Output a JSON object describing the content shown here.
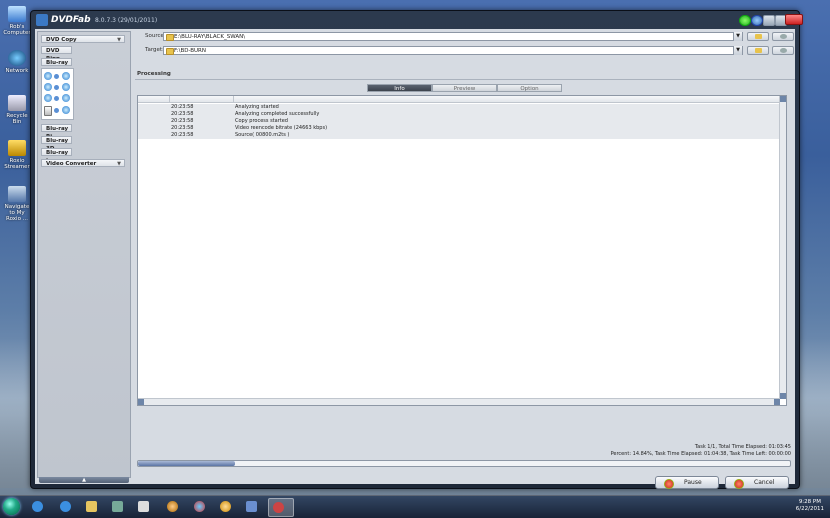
{
  "desktop": {
    "icons": [
      {
        "label": "Rob's Computer"
      },
      {
        "label": "Network"
      },
      {
        "label": "Recycle Bin"
      },
      {
        "label": "Roxio Streamer"
      },
      {
        "label": "Navigate to My Roxio ..."
      }
    ]
  },
  "window": {
    "app_name": "DVDFab",
    "version": "8.0.7.3 (29/01/2011)"
  },
  "sidebar": {
    "items": [
      {
        "label": "DVD Copy"
      },
      {
        "label": "DVD Ripp"
      },
      {
        "label": "Blu-ray Co"
      },
      {
        "label": "Blu-ray Ri"
      },
      {
        "label": "Blu-ray 3D"
      },
      {
        "label": "Blu-ray to"
      },
      {
        "label": "Video Converter"
      }
    ]
  },
  "source": {
    "label": "Source:",
    "value": "E:\\BLU-RAY\\BLACK_SWAN\\"
  },
  "target": {
    "label": "Target:",
    "value": "F:\\BD-BURN"
  },
  "section": {
    "title": "Processing"
  },
  "tabs": [
    {
      "label": "Info"
    },
    {
      "label": "Preview"
    },
    {
      "label": "Option"
    }
  ],
  "log": {
    "rows": [
      {
        "time": "20:23:58",
        "message": "Analyzing started"
      },
      {
        "time": "20:23:58",
        "message": "Analyzing completed successfully"
      },
      {
        "time": "20:23:58",
        "message": "Copy process started"
      },
      {
        "time": "20:23:58",
        "message": "Video reencode bitrate (24663 kbps)"
      },
      {
        "time": "20:23:58",
        "message": "Source( 00800.m2ts )"
      }
    ]
  },
  "status": {
    "line1": "Task 1/1,  Total Time Elapsed: 01:03:45",
    "line2": "Percent: 14.84%,  Task Time Elapsed: 01:04:38,  Task Time Left: 00:00:00"
  },
  "progress": {
    "percent": 14.84
  },
  "buttons": {
    "pause": "Pause",
    "cancel": "Cancel"
  },
  "clock": {
    "time": "9:28 PM",
    "date": "6/22/2011"
  },
  "colors": {
    "accent": "#3b79c4",
    "titlebar": "#2c3a4e"
  }
}
